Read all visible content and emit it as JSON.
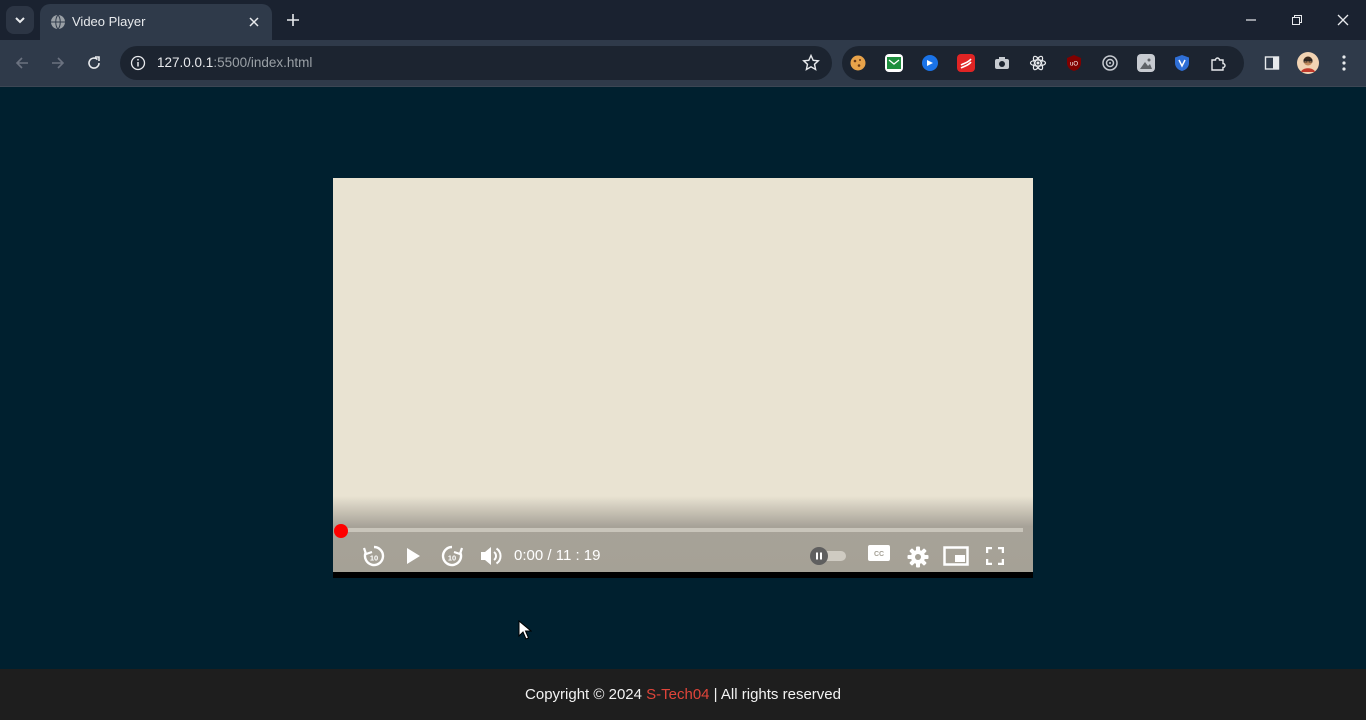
{
  "browser": {
    "tab": {
      "title": "Video Player",
      "favicon": "globe-icon"
    },
    "address": {
      "scheme_host": "127.0.0.1",
      "rest": ":5500/index.html"
    },
    "extensions": [
      "cookie-icon",
      "sheets-icon",
      "chat-icon",
      "red-app-icon",
      "camera-icon",
      "react-icon",
      "ublock-icon",
      "target-icon",
      "image-icon",
      "shield-icon",
      "puzzle-icon"
    ],
    "colors": {
      "frame": "#1a2230",
      "toolbar": "#2f3a4a"
    }
  },
  "player": {
    "current_time": "0:00",
    "separator": "/",
    "duration": "11 : 19",
    "progress": 0,
    "autoplay_on": false,
    "colors": {
      "progress_thumb": "#ff0000",
      "screen": "#e9e3d2"
    },
    "controls": [
      "rewind-10-icon",
      "play-icon",
      "forward-10-icon",
      "volume-icon",
      "autoplay-toggle",
      "captions-icon",
      "settings-icon",
      "miniplayer-icon",
      "fullscreen-icon"
    ]
  },
  "footer": {
    "prefix": "Copyright © 2024 ",
    "brand": "S-Tech04",
    "suffix": " | All rights reserved",
    "colors": {
      "brand": "#e0453a",
      "background": "#1e1e1e"
    }
  },
  "page": {
    "background": "#00202f"
  }
}
